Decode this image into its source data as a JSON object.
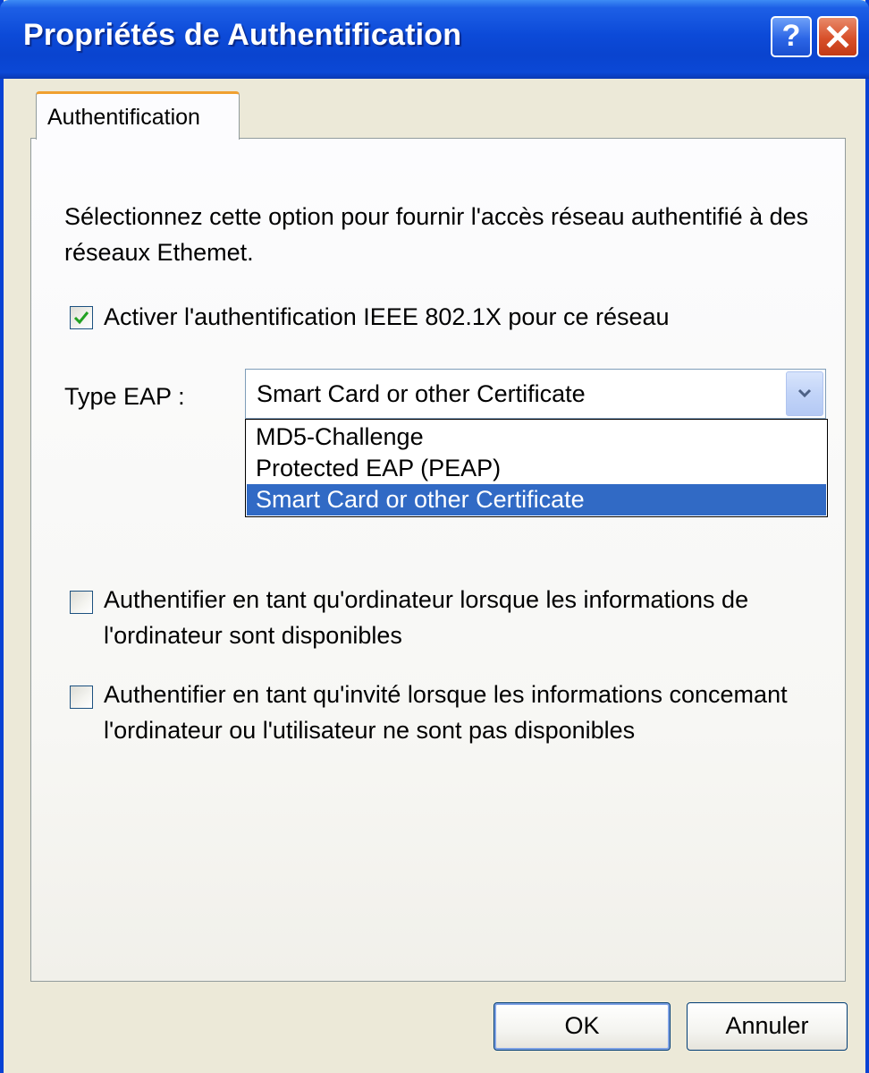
{
  "window": {
    "title": "Propriétés de Authentification",
    "help_glyph": "?",
    "colors": {
      "titlebar": "#0842d4",
      "dialog_bg": "#ece9d8",
      "tab_accent": "#f0a030",
      "selection": "#316ac5",
      "close_button": "#d8502a"
    }
  },
  "tabs": [
    {
      "label": "Authentification",
      "active": true
    }
  ],
  "main": {
    "description": "Sélectionnez cette option pour fournir l'accès réseau authentifié à des réseaux Ethemet.",
    "enable_8021x": {
      "label": "Activer l'authentification IEEE 802.1X pour ce réseau",
      "checked": true
    },
    "eap_type": {
      "label": "Type EAP :",
      "selected": "Smart Card or other Certificate",
      "options": [
        "MD5-Challenge",
        "Protected EAP (PEAP)",
        "Smart Card or other Certificate"
      ],
      "expanded": true
    },
    "auth_computer": {
      "label": "Authentifier en tant qu'ordinateur lorsque les informations de l'ordinateur sont disponibles",
      "checked": false
    },
    "auth_guest": {
      "label": "Authentifier en tant qu'invité lorsque les informations concemant l'ordinateur ou l'utilisateur ne sont pas disponibles",
      "checked": false
    }
  },
  "footer": {
    "ok_label": "OK",
    "cancel_label": "Annuler"
  },
  "icons": {
    "help": "help-icon",
    "close": "close-icon",
    "checkmark": "checkmark-icon",
    "dropdown": "chevron-down-icon"
  }
}
